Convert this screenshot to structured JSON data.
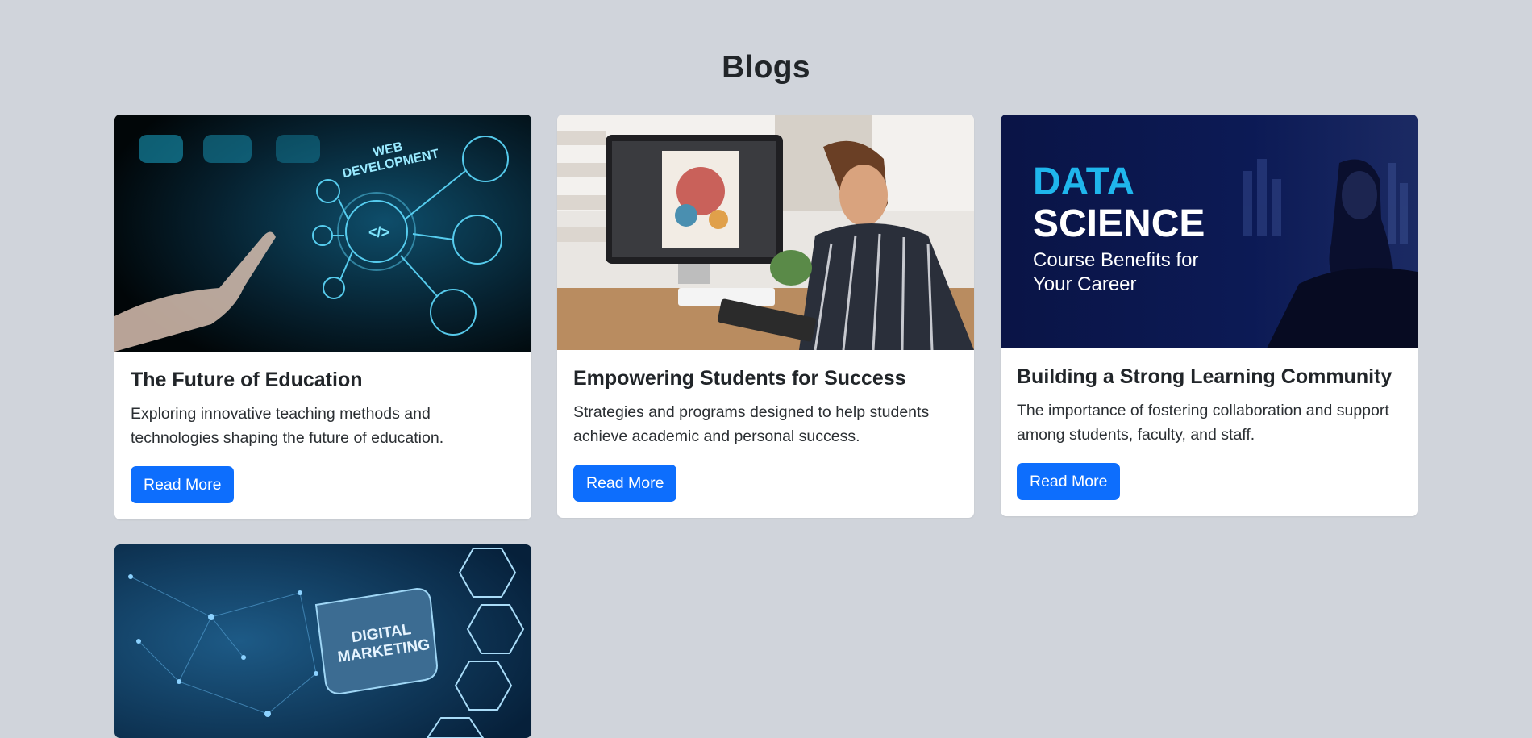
{
  "page": {
    "title": "Blogs"
  },
  "colors": {
    "background": "#d0d4db",
    "card": "#ffffff",
    "button": "#0d6efd",
    "text": "#212529"
  },
  "cards": [
    {
      "title": "The Future of Education",
      "text": "Exploring innovative teaching methods and technologies shaping the future of education.",
      "button": "Read More",
      "image": {
        "icon": "web-development-image",
        "label_lines": [
          "WEB",
          "DEVELOPMENT"
        ]
      }
    },
    {
      "title": "Empowering Students for Success",
      "text": "Strategies and programs designed to help students achieve academic and personal success.",
      "button": "Read More",
      "image": {
        "icon": "designer-at-desk-image"
      }
    },
    {
      "title": "Building a Strong Learning Community",
      "text": "The importance of fostering collaboration and support among students, faculty, and staff.",
      "button": "Read More",
      "image": {
        "icon": "data-science-image",
        "label_lines": [
          "DATA",
          "SCIENCE",
          "Course Benefits for",
          "Your Career"
        ]
      }
    },
    {
      "title": "",
      "text": "",
      "button": "",
      "image": {
        "icon": "digital-marketing-image",
        "label_lines": [
          "DIGITAL",
          "MARKETING"
        ]
      }
    }
  ]
}
